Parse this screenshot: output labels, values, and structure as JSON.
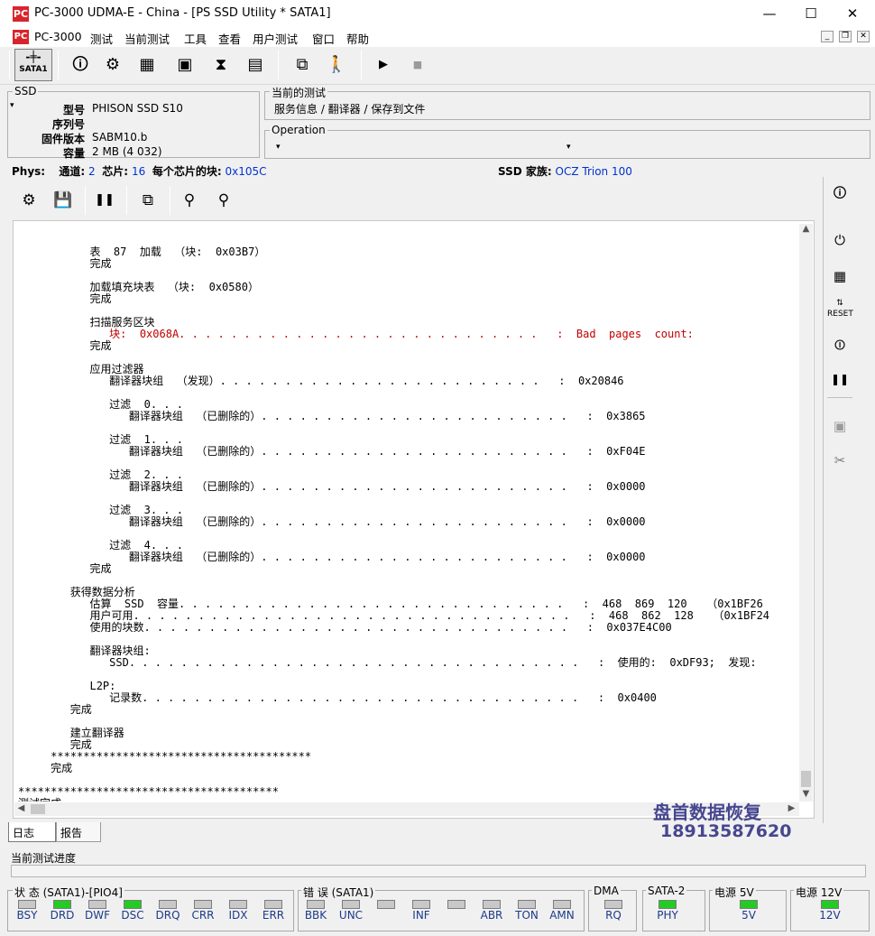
{
  "window": {
    "title": "PC-3000 UDMA-E - China - [PS SSD Utility * SATA1]",
    "app_icon_label": "PC",
    "minimize_glyph": "—",
    "maximize_glyph": "☐",
    "close_glyph": "✕"
  },
  "menu": {
    "items": [
      "PC-3000",
      "测试",
      "当前测试",
      "工具",
      "查看",
      "用户测试",
      "窗口",
      "帮助"
    ]
  },
  "toolbar": {
    "sata_button_label": "SATA1",
    "buttons": [
      "info-icon",
      "chip-icon",
      "memory-icon",
      "module-icon",
      "hourglass-icon",
      "grid-icon",
      "copy-icon",
      "run-icon",
      "play-icon",
      "stop-icon"
    ]
  },
  "ssd": {
    "group_title": "SSD",
    "fields": [
      {
        "label": "型号",
        "value": "PHISON SSD S10"
      },
      {
        "label": "序列号",
        "value": ""
      },
      {
        "label": "固件版本",
        "value": "SABM10.b"
      },
      {
        "label": "容量",
        "value": "2 MB (4 032)"
      }
    ]
  },
  "current_test": {
    "group_title": "当前的测试",
    "path": "服务信息 / 翻译器 / 保存到文件"
  },
  "operation": {
    "group_title": "Operation",
    "value": ""
  },
  "phys": {
    "label": "Phys:",
    "channels_label": "通道:",
    "channels": "2",
    "chips_label": "芯片:",
    "chips": "16",
    "blocks_label": "每个芯片的块:",
    "blocks": "0x105C",
    "family_label": "SSD 家族:",
    "family": "OCZ Trion 100"
  },
  "log": {
    "lines": [
      {
        "t": "",
        "c": ""
      },
      {
        "t": "           表  87  加载  （块:  0x03B7）",
        "c": ""
      },
      {
        "t": "           完成",
        "c": ""
      },
      {
        "t": "",
        "c": ""
      },
      {
        "t": "           加载填充块表  （块:  0x0580）",
        "c": ""
      },
      {
        "t": "           完成",
        "c": ""
      },
      {
        "t": "",
        "c": ""
      },
      {
        "t": "           扫描服务区块",
        "c": ""
      },
      {
        "t": "              块:  0x068A. . . . . . . . . . . . . . . . . . . . . . . . . . . .   :  Bad  pages  count:",
        "c": "red"
      },
      {
        "t": "           完成",
        "c": ""
      },
      {
        "t": "",
        "c": ""
      },
      {
        "t": "           应用过滤器",
        "c": ""
      },
      {
        "t": "              翻译器块组  （发现）. . . . . . . . . . . . . . . . . . . . . . . . .   :  0x20846",
        "c": ""
      },
      {
        "t": "",
        "c": ""
      },
      {
        "t": "              过滤  0. . .",
        "c": ""
      },
      {
        "t": "                 翻译器块组  （已删除的）. . . . . . . . . . . . . . . . . . . . . . . .   :  0x3865",
        "c": ""
      },
      {
        "t": "",
        "c": ""
      },
      {
        "t": "              过滤  1. . .",
        "c": ""
      },
      {
        "t": "                 翻译器块组  （已删除的）. . . . . . . . . . . . . . . . . . . . . . . .   :  0xF04E",
        "c": ""
      },
      {
        "t": "",
        "c": ""
      },
      {
        "t": "              过滤  2. . .",
        "c": ""
      },
      {
        "t": "                 翻译器块组  （已删除的）. . . . . . . . . . . . . . . . . . . . . . . .   :  0x0000",
        "c": ""
      },
      {
        "t": "",
        "c": ""
      },
      {
        "t": "              过滤  3. . .",
        "c": ""
      },
      {
        "t": "                 翻译器块组  （已删除的）. . . . . . . . . . . . . . . . . . . . . . . .   :  0x0000",
        "c": ""
      },
      {
        "t": "",
        "c": ""
      },
      {
        "t": "              过滤  4. . .",
        "c": ""
      },
      {
        "t": "                 翻译器块组  （已删除的）. . . . . . . . . . . . . . . . . . . . . . . .   :  0x0000",
        "c": ""
      },
      {
        "t": "           完成",
        "c": ""
      },
      {
        "t": "",
        "c": ""
      },
      {
        "t": "        获得数据分析",
        "c": ""
      },
      {
        "t": "           估算  SSD  容量. . . . . . . . . . . . . . . . . . . . . . . . . . . . . .   :  468  869  120   （0x1BF26",
        "c": ""
      },
      {
        "t": "           用户可用. . . . . . . . . . . . . . . . . . . . . . . . . . . . . . . . . .   :  468  862  128   （0x1BF24",
        "c": ""
      },
      {
        "t": "           使用的块数. . . . . . . . . . . . . . . . . . . . . . . . . . . . . . . . .   :  0x037E4C00",
        "c": ""
      },
      {
        "t": "",
        "c": ""
      },
      {
        "t": "           翻译器块组:",
        "c": ""
      },
      {
        "t": "              SSD. . . . . . . . . . . . . . . . . . . . . . . . . . . . . . . . . . .   :  使用的:  0xDF93;  发现:",
        "c": ""
      },
      {
        "t": "",
        "c": ""
      },
      {
        "t": "           L2P:",
        "c": ""
      },
      {
        "t": "              记录数. . . . . . . . . . . . . . . . . . . . . . . . . . . . . . . . . .   :  0x0400",
        "c": ""
      },
      {
        "t": "        完成",
        "c": ""
      },
      {
        "t": "",
        "c": ""
      },
      {
        "t": "        建立翻译器",
        "c": ""
      },
      {
        "t": "        完成",
        "c": ""
      },
      {
        "t": "     ****************************************",
        "c": ""
      },
      {
        "t": "     完成",
        "c": ""
      },
      {
        "t": "",
        "c": ""
      },
      {
        "t": "****************************************",
        "c": ""
      },
      {
        "t": "测试完成",
        "c": ""
      }
    ]
  },
  "tabs": [
    {
      "label": "日志",
      "active": true
    },
    {
      "label": "报告",
      "active": false
    }
  ],
  "watermark": {
    "line1": "盘首数据恢复",
    "line2": "18913587620"
  },
  "progress": {
    "label": "当前测试进度",
    "value": 0
  },
  "status": {
    "state": {
      "title": "状 态 (SATA1)-[PIO4]",
      "leds": [
        {
          "label": "BSY",
          "on": false
        },
        {
          "label": "DRD",
          "on": true
        },
        {
          "label": "DWF",
          "on": false
        },
        {
          "label": "DSC",
          "on": true
        },
        {
          "label": "DRQ",
          "on": false
        },
        {
          "label": "CRR",
          "on": false
        },
        {
          "label": "IDX",
          "on": false
        },
        {
          "label": "ERR",
          "on": false
        }
      ]
    },
    "error": {
      "title": "错 误 (SATA1)",
      "leds": [
        {
          "label": "BBK",
          "on": false
        },
        {
          "label": "UNC",
          "on": false
        },
        {
          "label": "",
          "on": false
        },
        {
          "label": "INF",
          "on": false
        },
        {
          "label": "",
          "on": false
        },
        {
          "label": "ABR",
          "on": false
        },
        {
          "label": "TON",
          "on": false
        },
        {
          "label": "AMN",
          "on": false
        }
      ]
    },
    "dma": {
      "title": "DMA",
      "leds": [
        {
          "label": "RQ",
          "on": false
        }
      ]
    },
    "sata2": {
      "title": "SATA-2",
      "leds": [
        {
          "label": "PHY",
          "on": true
        }
      ]
    },
    "power5": {
      "title": "电源 5V",
      "leds": [
        {
          "label": "5V",
          "on": true
        }
      ]
    },
    "power12": {
      "title": "电源 12V",
      "leds": [
        {
          "label": "12V",
          "on": true
        }
      ]
    }
  },
  "colors": {
    "accent_blue": "#0033cc",
    "log_error_red": "#c00000",
    "led_on": "#22cc22",
    "led_off": "#c8c8c8"
  }
}
